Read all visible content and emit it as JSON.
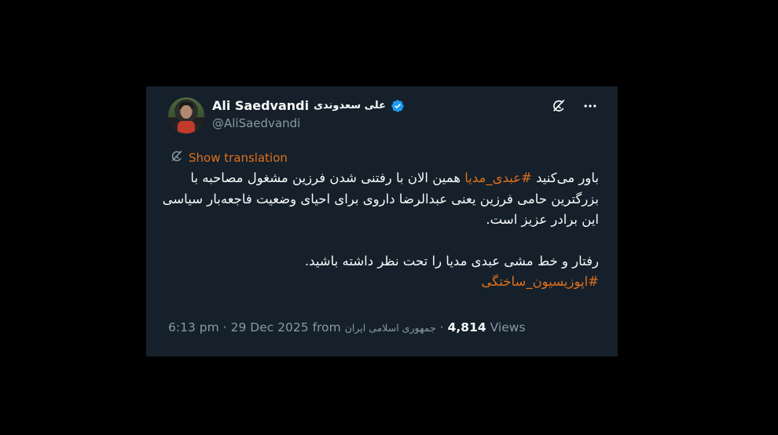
{
  "user": {
    "display_name": "Ali Saedvandi",
    "display_name_fa": "علی سعدوندی",
    "handle": "@AliSaedvandi"
  },
  "translation": {
    "label": "Show translation"
  },
  "tweet": {
    "line1_pre": "باور می‌کنید ",
    "hashtag1": "#عبدی_مدیا",
    "line1_post": " همین الان با رفتنی شدن فرزین مشغول مصاحبه با بزرگترین حامی فرزین یعنی عبدالرضا داروی برای احیای وضعیت فاجعه‌بار سیاسی این برادر عزیز است.",
    "line2": "رفتار و خط مشی عبدی مدیا را تحت نظر داشته باشید.",
    "hashtag2": "#اپوزیسیون_ساختگی"
  },
  "meta": {
    "time": "6:13 pm",
    "separator1": "·",
    "date": "29 Dec 2025",
    "from_label": "from",
    "source": "جمهوری اسلامی ایران",
    "separator2": "·",
    "views_count": "4,814",
    "views_label": "Views"
  },
  "colors": {
    "card_bg": "#15202b",
    "accent": "#e0701a",
    "muted": "#8b98a5",
    "verified": "#1d9bf0"
  },
  "icons": {
    "verified": "verified-badge-icon",
    "grok": "grok-icon",
    "more": "more-icon",
    "translate": "translate-icon"
  }
}
